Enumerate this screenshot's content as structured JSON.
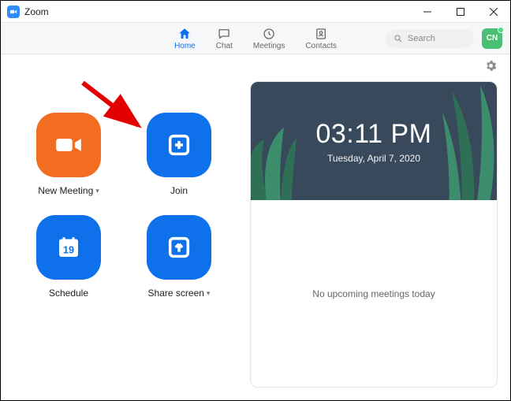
{
  "titlebar": {
    "app_name": "Zoom"
  },
  "nav": {
    "home": "Home",
    "chat": "Chat",
    "meetings": "Meetings",
    "contacts": "Contacts"
  },
  "search": {
    "placeholder": "Search"
  },
  "avatar": {
    "initials": "CN"
  },
  "actions": {
    "new_meeting": "New Meeting",
    "join": "Join",
    "schedule": "Schedule",
    "share_screen": "Share screen",
    "calendar_day": "19"
  },
  "clock": {
    "time": "03:11 PM",
    "date": "Tuesday, April 7, 2020"
  },
  "upcoming": {
    "empty_text": "No upcoming meetings today"
  },
  "colors": {
    "brand_blue": "#0E71EB",
    "action_orange": "#F26D21",
    "clock_bg": "#39495C"
  }
}
